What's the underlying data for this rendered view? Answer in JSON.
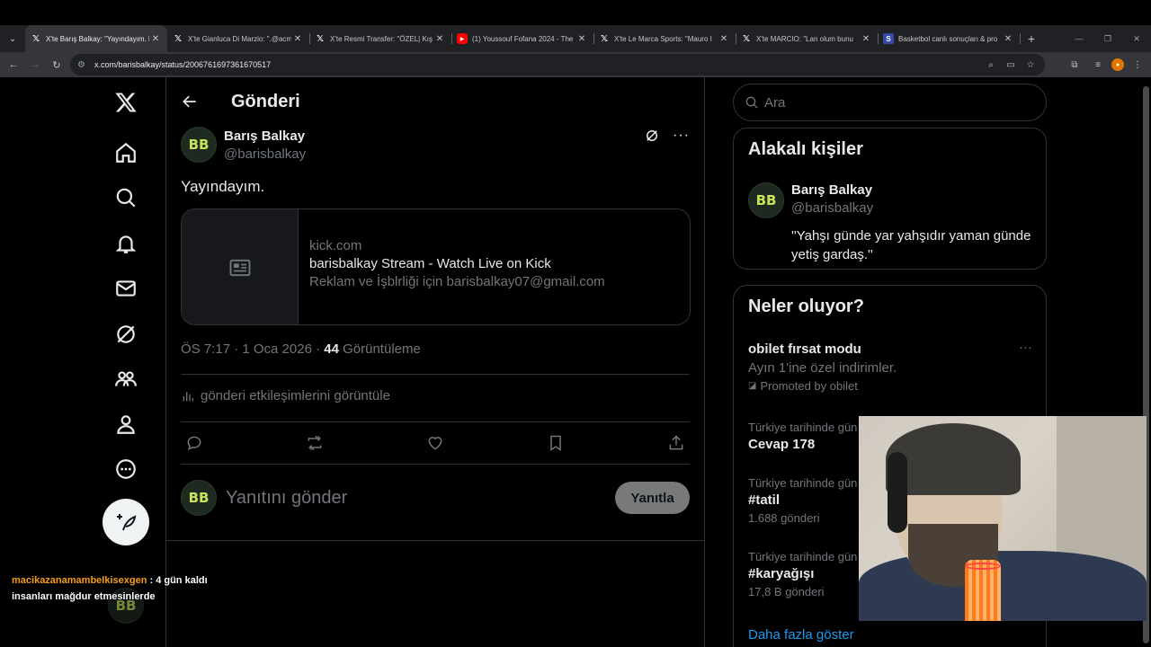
{
  "browser": {
    "tabs": [
      {
        "title": "X'te Barış Balkay: \"Yayındayım. h",
        "icon": "x-logo",
        "active": true
      },
      {
        "title": "X'te Gianluca Di Marzio: \".@acm",
        "icon": "x-logo",
        "active": false
      },
      {
        "title": "X'te Resmi Transfer: \"ÖZEL| Kış",
        "icon": "x-logo",
        "active": false
      },
      {
        "title": "(1) Youssouf Fofana 2024 - The",
        "icon": "youtube-logo",
        "active": false
      },
      {
        "title": "X'te Le Marca Sports: \"Mauro I",
        "icon": "x-logo",
        "active": false
      },
      {
        "title": "X'te MARCIO: \"Lan olum bunu",
        "icon": "x-logo",
        "active": false
      },
      {
        "title": "Basketbol canlı sonuçları & pro",
        "icon": "flashscore-logo",
        "active": false
      }
    ],
    "url": "x.com/barisbalkay/status/2006761697361670517"
  },
  "header": {
    "title": "Gönderi"
  },
  "tweet": {
    "avatar_text": "BB",
    "display_name": "Barış Balkay",
    "handle": "@barisbalkay",
    "text": "Yayındayım.",
    "card": {
      "domain": "kick.com",
      "title": "barisbalkay Stream - Watch Live on Kick",
      "description": "Reklam ve İşblrliği için barisbalkay07@gmail.com"
    },
    "time": "ÖS 7:17 · 1 Oca 2026 · ",
    "views_count": "44",
    "views_label": " Görüntüleme",
    "analytics_label": "gönderi etkileşimlerini görüntüle",
    "reply_placeholder": "Yanıtını gönder",
    "reply_button": "Yanıtla"
  },
  "sidebar": {
    "search_placeholder": "Ara",
    "related_title": "Alakalı kişiler",
    "related_user": {
      "display_name": "Barış Balkay",
      "handle": "@barisbalkay",
      "bio": "''Yahşı günde yar yahşıdır yaman günde yetiş gardaş.''"
    },
    "trends_title": "Neler oluyor?",
    "promoted": {
      "name": "obilet fırsat modu",
      "description": "Ayın 1'ine özel indirimler.",
      "promoted_by": "Promoted by obilet"
    },
    "trends": [
      {
        "context": "Türkiye tarihinde gün",
        "name": "Cevap 178",
        "sub": ""
      },
      {
        "context": "Türkiye tarihinde gün",
        "name": "#tatil",
        "sub": "1.688 gönderi"
      },
      {
        "context": "Türkiye tarihinde gün",
        "name": "#karyağışı",
        "sub": "17,8 B gönderi"
      }
    ],
    "show_more": "Daha fazla göster"
  },
  "chat": {
    "user": "macikazanamambelkisexgen",
    "message": " : 4 gün kaldı insanları mağdur etmesinlerde"
  }
}
